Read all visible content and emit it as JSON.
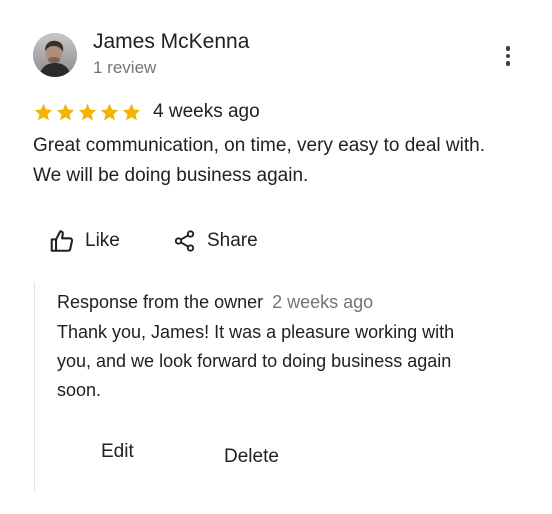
{
  "reviewer": {
    "name": "James McKenna",
    "meta": "1 review"
  },
  "rating": {
    "stars": 5,
    "max_stars": 5,
    "star_color": "#f4b400",
    "time": "4 weeks ago"
  },
  "review": {
    "text_line1": "Great communication, on time, very easy to deal with.",
    "text_line2": "We will be doing business again."
  },
  "actions": {
    "like_label": "Like",
    "share_label": "Share"
  },
  "owner_response": {
    "title": "Response from the owner",
    "time": "2 weeks ago",
    "text_line1": "Thank you, James! It was a pleasure working with",
    "text_line2": "you, and we look forward to doing business again",
    "text_line3": "soon.",
    "edit_label": "Edit",
    "delete_label": "Delete"
  },
  "icons": {
    "avatar": "avatar-photo",
    "more": "more-vert-icon",
    "star": "star-icon",
    "like": "thumb-up-icon",
    "share": "share-icon"
  }
}
